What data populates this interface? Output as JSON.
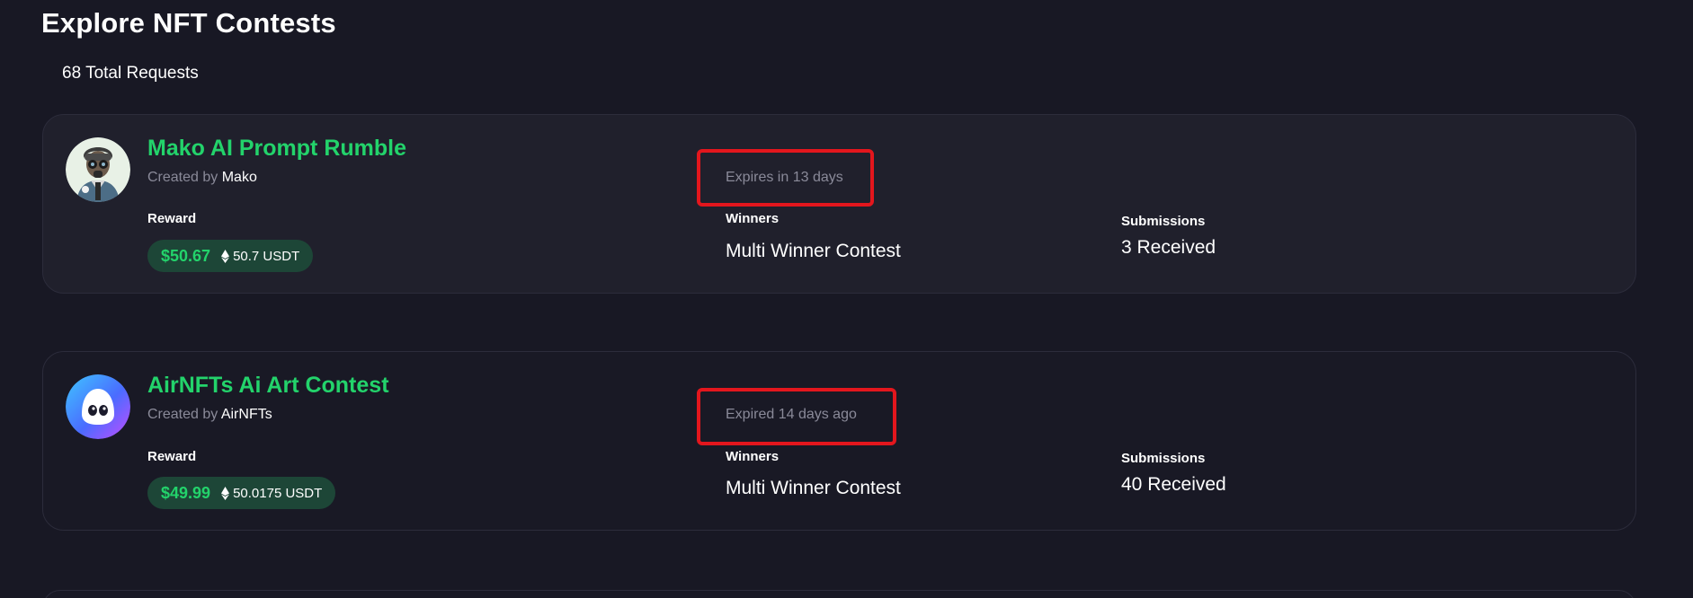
{
  "page": {
    "title": "Explore NFT Contests",
    "total_requests": "68 Total Requests"
  },
  "contests": [
    {
      "title": "Mako AI Prompt Rumble",
      "created_by_prefix": "Created by",
      "creator": "Mako",
      "avatar_icon": "masked-character-avatar",
      "expiry": "Expires in 13 days",
      "reward_label": "Reward",
      "reward_usd": "$50.67",
      "reward_token": "50.7 USDT",
      "winners_label": "Winners",
      "winners_value": "Multi Winner Contest",
      "submissions_label": "Submissions",
      "submissions_value": "3 Received"
    },
    {
      "title": "AirNFTs Ai Art Contest",
      "created_by_prefix": "Created by",
      "creator": "AirNFTs",
      "avatar_icon": "airnfts-ghost-logo",
      "expiry": "Expired 14 days ago",
      "reward_label": "Reward",
      "reward_usd": "$49.99",
      "reward_token": "50.0175 USDT",
      "winners_label": "Winners",
      "winners_value": "Multi Winner Contest",
      "submissions_label": "Submissions",
      "submissions_value": "40 Received"
    }
  ],
  "colors": {
    "background": "#181824",
    "accent_green": "#23d36b",
    "pill_bg": "#1d4637",
    "muted_text": "#8a8a99",
    "annotation_red": "#e3161d"
  }
}
